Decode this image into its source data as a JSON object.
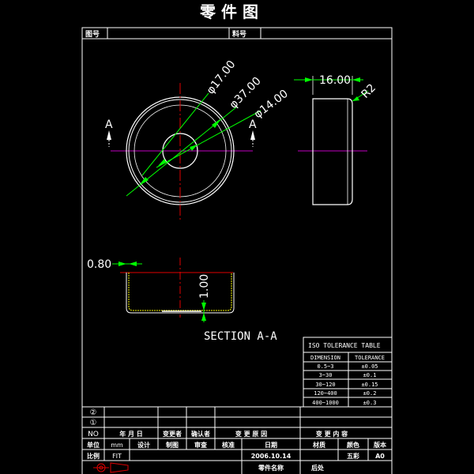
{
  "title": "零 件 图",
  "header": {
    "drawing_no_label": "图号",
    "material_label": "料号"
  },
  "dimensions": {
    "phi17": "φ17.00",
    "phi37": "φ37.00",
    "phi14": "φ14.00",
    "width16": "16.00",
    "r2": "R2",
    "t080": "0.80",
    "t100": "1.00",
    "section_mark": "A"
  },
  "section_label": "SECTION  A-A",
  "tolerance_table": {
    "title": "ISO TOLERANCE TABLE",
    "headers": [
      "DIMENSION",
      "TOLERANCE"
    ],
    "rows": [
      [
        "0.5~3",
        "±0.05"
      ],
      [
        "3~30",
        "±0.1"
      ],
      [
        "30~120",
        "±0.15"
      ],
      [
        "120~400",
        "±0.2"
      ],
      [
        "400~1000",
        "±0.3"
      ]
    ]
  },
  "revision": {
    "marks": [
      "②",
      "①"
    ],
    "no": "NO",
    "ymd": "年 月 日",
    "changer": "变更者",
    "confirmer": "确认者",
    "reason": "变 更 原 因",
    "content": "变 更 内 容"
  },
  "titleblock": {
    "unit_label": "单位",
    "unit_value": "mm",
    "design": "设计",
    "draw": "制图",
    "review": "审查",
    "approve": "核准",
    "date_label": "日期",
    "material": "材质",
    "color": "颜色",
    "version": "版本",
    "scale_label": "比例",
    "scale_value": "FIT",
    "date_value": "2006.10.14",
    "color_value": "五彩",
    "version_value": "A0",
    "part_name_label": "零件名称",
    "finish_label": "后处"
  }
}
